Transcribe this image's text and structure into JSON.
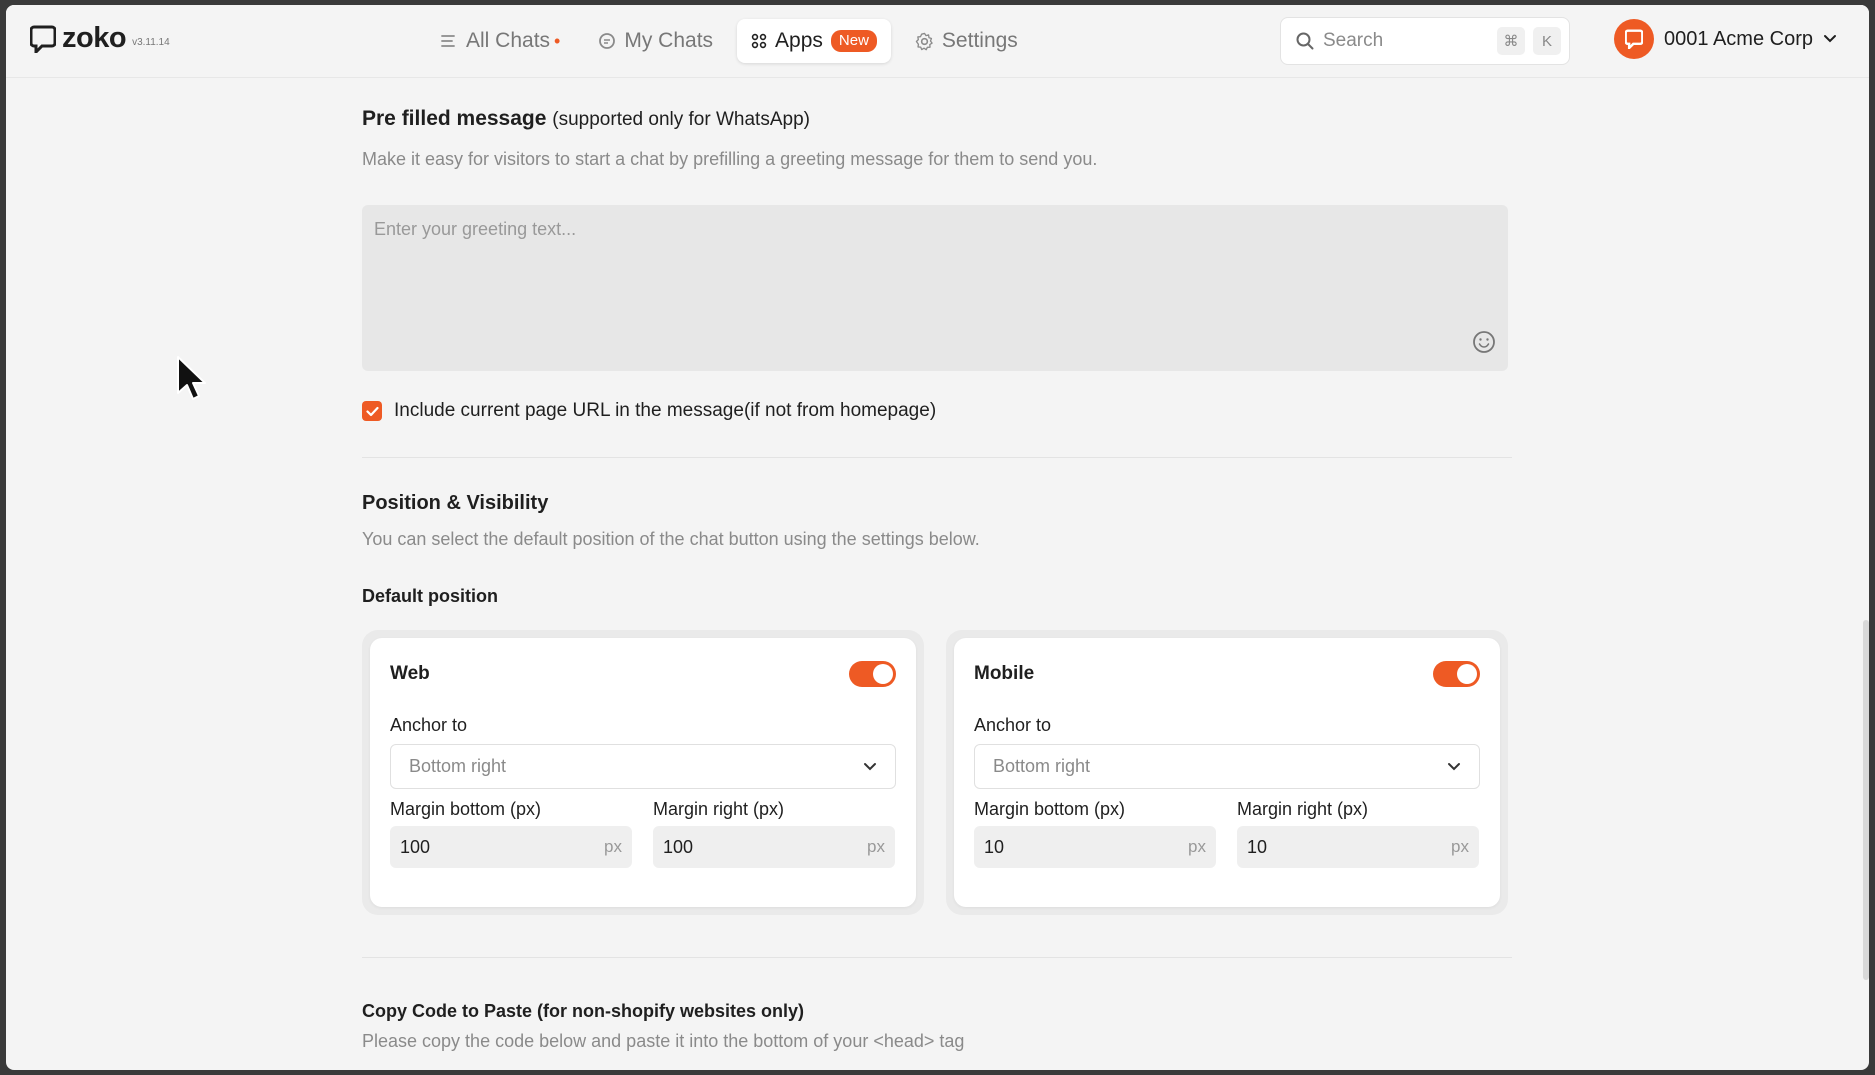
{
  "header": {
    "logo_text": "zoko",
    "version": "v3.11.14",
    "nav": [
      {
        "label": "All Chats",
        "icon": "list-icon",
        "dot": "•"
      },
      {
        "label": "My Chats",
        "icon": "chat-icon"
      },
      {
        "label": "Apps",
        "icon": "apps-grid-icon",
        "badge": "New",
        "active": true
      },
      {
        "label": "Settings",
        "icon": "gear-icon"
      }
    ],
    "search_placeholder": "Search",
    "shortcut_keys": [
      "⌘",
      "K"
    ],
    "account_name": "0001 Acme Corp"
  },
  "prefill": {
    "title": "Pre filled message",
    "title_note": "(supported only for WhatsApp)",
    "description": "Make it easy for visitors to start a chat by prefilling a greeting message for them to send you.",
    "placeholder": "Enter your greeting text...",
    "include_url_label": "Include current page URL in the message(if not from homepage)",
    "include_url_checked": true
  },
  "position": {
    "title": "Position & Visibility",
    "description": "You can select the default position of the chat button using the settings below.",
    "default_label": "Default position",
    "web": {
      "title": "Web",
      "enabled": true,
      "anchor_label": "Anchor to",
      "anchor_value": "Bottom right",
      "margin_bottom_label": "Margin bottom (px)",
      "margin_bottom": "100",
      "margin_right_label": "Margin right (px)",
      "margin_right": "100",
      "unit": "px"
    },
    "mobile": {
      "title": "Mobile",
      "enabled": true,
      "anchor_label": "Anchor to",
      "anchor_value": "Bottom right",
      "margin_bottom_label": "Margin bottom (px)",
      "margin_bottom": "10",
      "margin_right_label": "Margin right (px)",
      "margin_right": "10",
      "unit": "px"
    }
  },
  "code": {
    "title": "Copy Code to Paste (for non-shopify websites only)",
    "description": "Please copy the code below and paste it into the bottom of your <head> tag"
  },
  "colors": {
    "accent": "#ee5a24",
    "background": "#f4f4f4"
  }
}
